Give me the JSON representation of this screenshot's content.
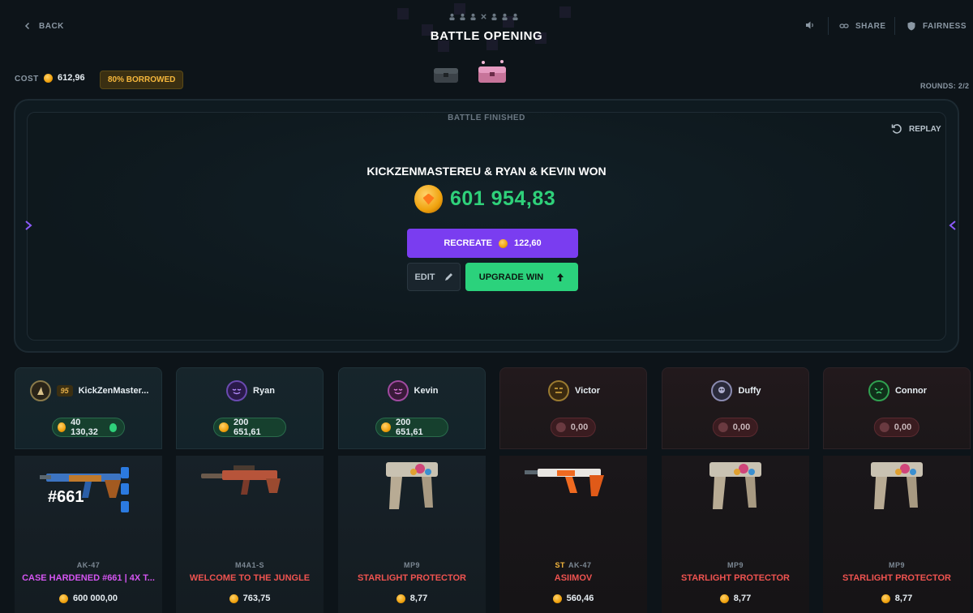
{
  "header": {
    "back": "BACK",
    "title": "BATTLE OPENING",
    "share": "SHARE",
    "fairness": "FAIRNESS"
  },
  "cost": {
    "label": "COST",
    "value": "612,96",
    "borrowed": "80% BORROWED",
    "rounds": "ROUNDS: 2/2"
  },
  "battle": {
    "status": "BATTLE FINISHED",
    "replay": "REPLAY",
    "winners": "KICKZENMASTEREU & RYAN & KEVIN  WON",
    "amount": "601 954,83",
    "recreate": "RECREATE",
    "recreate_cost": "122,60",
    "edit": "EDIT",
    "upgrade": "UPGRADE WIN"
  },
  "players": [
    {
      "name": "KickZenMaster...",
      "level": "95",
      "balance": "40 130,32",
      "result": "win",
      "item": {
        "type": "AK-47",
        "name": "CASE HARDENED #661 | 4X T...",
        "price": "600 000,00",
        "tag": "#661",
        "rarity": "purple"
      }
    },
    {
      "name": "Ryan",
      "balance": "200 651,61",
      "result": "win",
      "item": {
        "type": "M4A1-S",
        "name": "WELCOME TO THE JUNGLE",
        "price": "763,75"
      }
    },
    {
      "name": "Kevin",
      "balance": "200 651,61",
      "result": "win",
      "item": {
        "type": "MP9",
        "name": "STARLIGHT PROTECTOR",
        "price": "8,77"
      }
    },
    {
      "name": "Victor",
      "balance": "0,00",
      "result": "lose",
      "item": {
        "type": "AK-47",
        "stattrak": "ST",
        "name": "ASIIMOV",
        "price": "560,46"
      }
    },
    {
      "name": "Duffy",
      "balance": "0,00",
      "result": "lose",
      "item": {
        "type": "MP9",
        "name": "STARLIGHT PROTECTOR",
        "price": "8,77"
      }
    },
    {
      "name": "Connor",
      "balance": "0,00",
      "result": "lose",
      "item": {
        "type": "MP9",
        "name": "STARLIGHT PROTECTOR",
        "price": "8,77"
      }
    }
  ],
  "colors": {
    "accent_purple": "#7a3df0",
    "win_green": "#2bd27c",
    "coin_gold": "#f0a20e",
    "item_red": "#ef5350",
    "item_purple": "#d555f2"
  }
}
